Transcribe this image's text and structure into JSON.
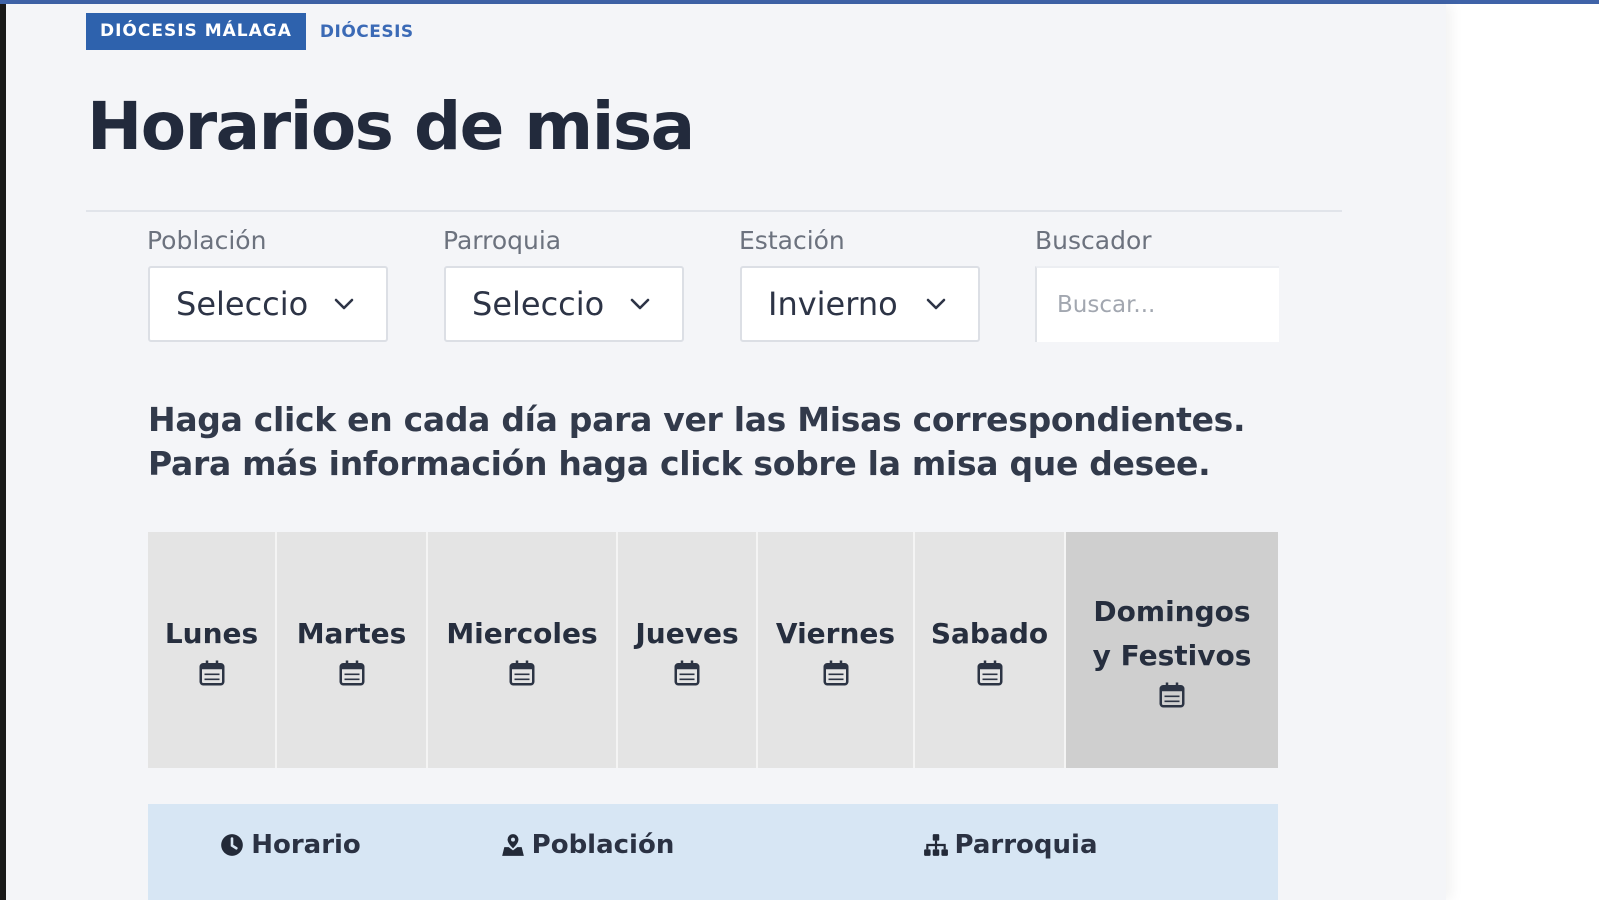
{
  "breadcrumb": {
    "primary": "DIÓCESIS MÁLAGA",
    "link": "DIÓCESIS"
  },
  "page_title": "Horarios de misa",
  "filters": {
    "poblacion": {
      "label": "Población",
      "value": "Seleccio"
    },
    "parroquia": {
      "label": "Parroquia",
      "value": "Seleccio"
    },
    "estacion": {
      "label": "Estación",
      "value": "Invierno"
    },
    "buscador": {
      "label": "Buscador",
      "placeholder": "Buscar..."
    }
  },
  "instructions": "Haga click en cada día para ver las Misas correspondientes. Para más información haga click sobre la misa que desee.",
  "days": [
    {
      "line1": "Lunes",
      "line2": ""
    },
    {
      "line1": "Martes",
      "line2": ""
    },
    {
      "line1": "Miercoles",
      "line2": ""
    },
    {
      "line1": "Jueves",
      "line2": ""
    },
    {
      "line1": "Viernes",
      "line2": ""
    },
    {
      "line1": "Sabado",
      "line2": ""
    },
    {
      "line1": "Domingos",
      "line2": "y Festivos"
    }
  ],
  "active_day": "Domingos y Festivos",
  "results_columns": {
    "horario": "Horario",
    "poblacion": "Población",
    "parroquia": "Parroquia"
  },
  "icons": {
    "calendar": "calendar-icon",
    "horario": "clock-icon",
    "poblacion": "map-icon",
    "parroquia": "sitemap-icon",
    "dropdown": "chevron-down-icon"
  },
  "colors": {
    "brand": "#2e62ad",
    "title": "#222a3c",
    "day_bg": "#e4e4e4",
    "day_active_bg": "#cfcfcf",
    "results_header_bg": "#d7e6f4"
  }
}
